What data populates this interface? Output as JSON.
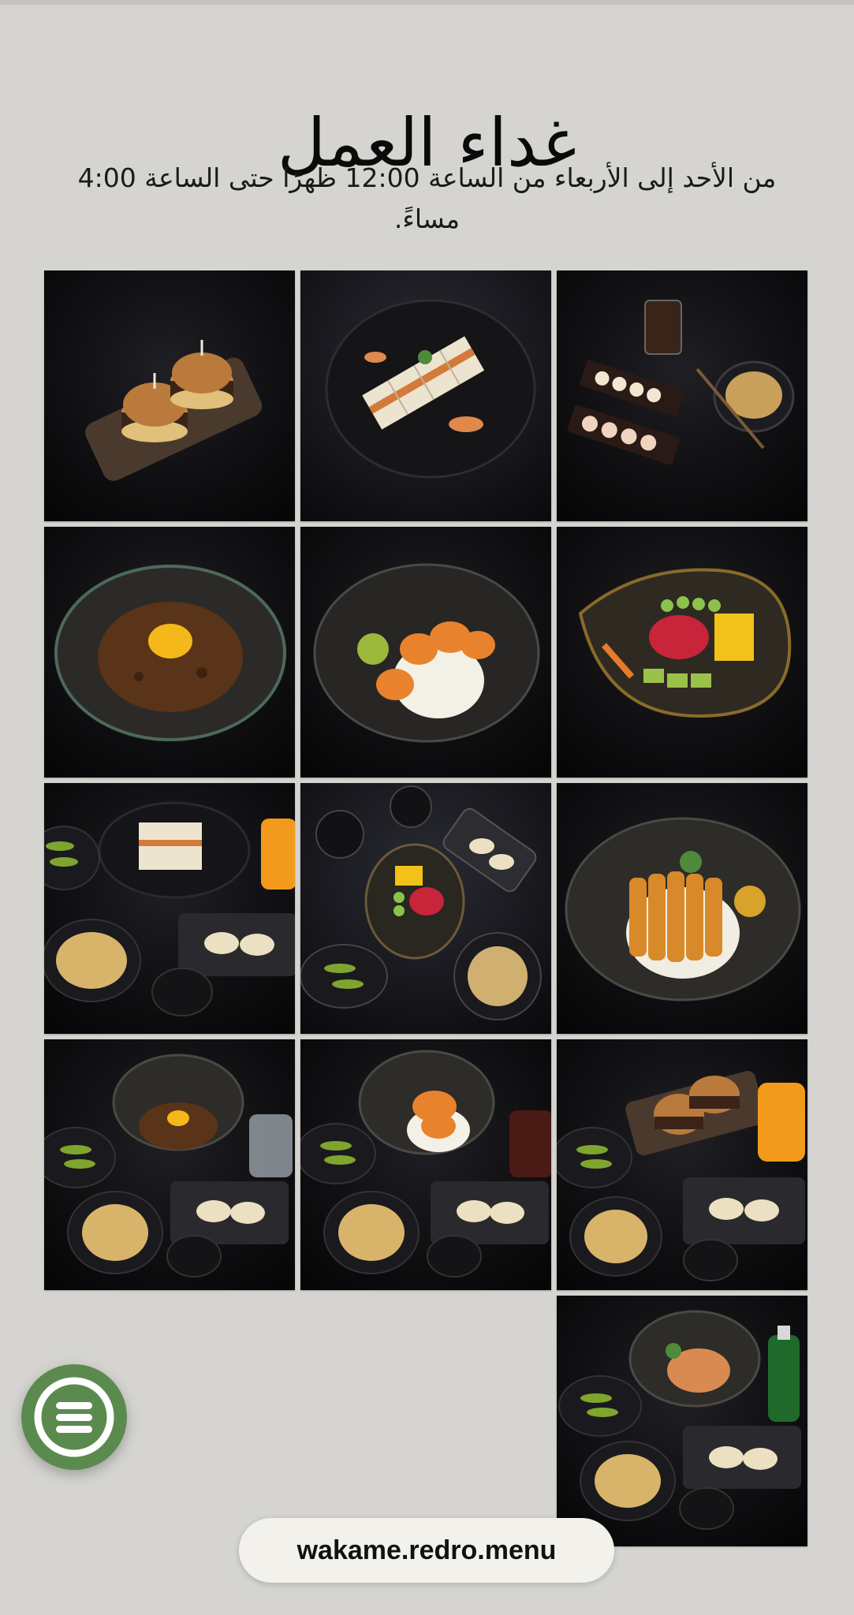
{
  "page": {
    "title": "غداء العمل",
    "subtitle": "من الأحد إلى الأربعاء من الساعة 12:00 ظهرًا حتى الساعة 4:00 مساءً."
  },
  "gallery": {
    "images": [
      {
        "name": "sliders-plate"
      },
      {
        "name": "katsu-sandwich-plate"
      },
      {
        "name": "sushi-noodles-set"
      },
      {
        "name": "beef-egg-rice-bowl"
      },
      {
        "name": "shrimp-rice-bowl"
      },
      {
        "name": "tuna-poke-bowl"
      },
      {
        "name": "sandwich-combo-set"
      },
      {
        "name": "poke-combo-set"
      },
      {
        "name": "chicken-katsu-bowl"
      },
      {
        "name": "beef-bowl-combo-set"
      },
      {
        "name": "shrimp-bowl-combo-set"
      },
      {
        "name": "sliders-combo-set"
      },
      {
        "name": "chicken-combo-set"
      }
    ]
  },
  "menu_button": {
    "icon": "menu-logo-icon",
    "color": "#5b8a4e"
  },
  "url_bar": {
    "text": "wakame.redro.menu"
  }
}
